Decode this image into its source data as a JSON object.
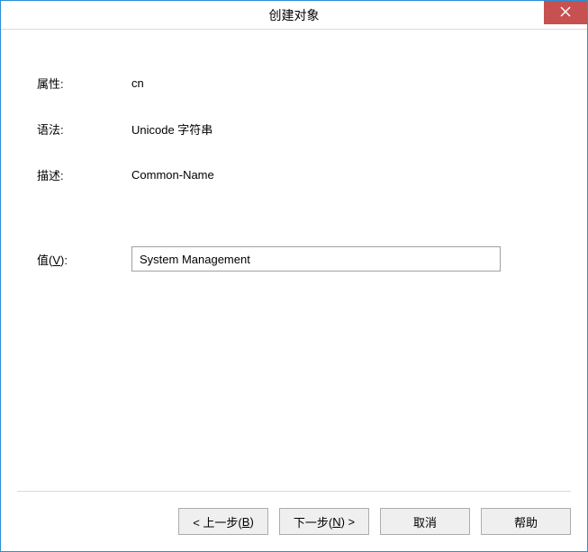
{
  "window": {
    "title": "创建对象"
  },
  "form": {
    "attribute_label": "属性:",
    "attribute_value": "cn",
    "syntax_label": "语法:",
    "syntax_value": "Unicode 字符串",
    "description_label": "描述:",
    "description_value": "Common-Name",
    "value_label_prefix": "值(",
    "value_label_hotkey": "V",
    "value_label_suffix": "):",
    "value_input": "System Management"
  },
  "buttons": {
    "back_prefix": "< 上一步(",
    "back_hotkey": "B",
    "back_suffix": ")",
    "next_prefix": "下一步(",
    "next_hotkey": "N",
    "next_suffix": ") >",
    "cancel": "取消",
    "help": "帮助"
  }
}
